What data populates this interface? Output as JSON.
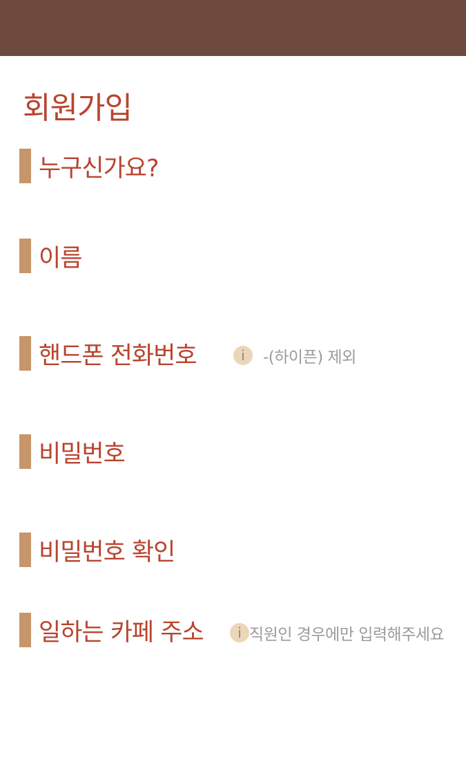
{
  "colors": {
    "header_bar": "#6e4a3e",
    "title_text": "#b8442e",
    "section_bar": "#c7956a",
    "info_icon_bg": "#ecd6b8",
    "hint_text": "#9b9b9b"
  },
  "page": {
    "title": "회원가입"
  },
  "sections": {
    "who": {
      "label": "누구신가요?"
    },
    "name": {
      "label": "이름"
    },
    "phone": {
      "label": "핸드폰 전화번호",
      "hint_icon": "i",
      "hint": "-(하이픈) 제외"
    },
    "password": {
      "label": "비밀번호"
    },
    "password_confirm": {
      "label": "비밀번호 확인"
    },
    "cafe_address": {
      "label": "일하는 카페 주소",
      "hint_icon": "i",
      "hint": "직원인 경우에만 입력해주세요"
    }
  }
}
